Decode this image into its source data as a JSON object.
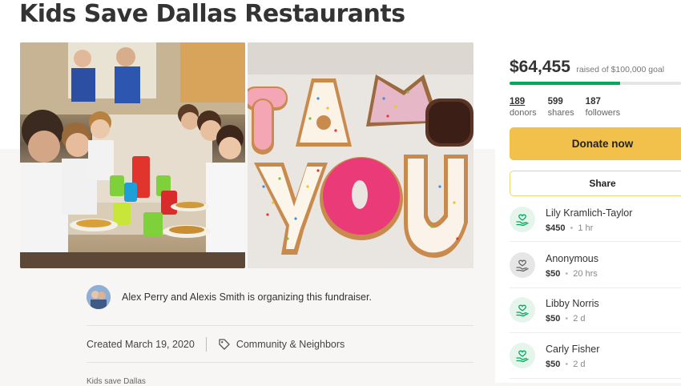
{
  "campaign": {
    "title": "Kids Save Dallas Restaurants",
    "organizer_text": "Alex Perry and Alexis Smith is organizing this fundraiser.",
    "created": "Created March 19, 2020",
    "category": "Community & Neighbors",
    "story_start": "Kids save Dallas"
  },
  "photos": {
    "right_letters": [
      "T",
      "H",
      "A",
      "N",
      "K",
      "Y",
      "O",
      "U"
    ]
  },
  "sidebar": {
    "raised": "$64,455",
    "goal_text": "raised of $100,000 goal",
    "progress_fraction": 0.645,
    "stats": [
      {
        "value": "189",
        "label": "donors"
      },
      {
        "value": "599",
        "label": "shares"
      },
      {
        "value": "187",
        "label": "followers"
      }
    ],
    "donate_label": "Donate now",
    "share_label": "Share",
    "donations": [
      {
        "name": "Lily Kramlich-Taylor",
        "amount": "$450",
        "time": "1 hr",
        "icon": "heart-hand-icon",
        "color": "#e6f5ec"
      },
      {
        "name": "Anonymous",
        "amount": "$50",
        "time": "20 hrs",
        "icon": "heart-hand-icon",
        "color": "#e6e6e6"
      },
      {
        "name": "Libby Norris",
        "amount": "$50",
        "time": "2 d",
        "icon": "heart-hand-icon",
        "color": "#e6f5ec"
      },
      {
        "name": "Carly Fisher",
        "amount": "$50",
        "time": "2 d",
        "icon": "heart-hand-icon",
        "color": "#e6f5ec"
      }
    ]
  },
  "colors": {
    "accent_green": "#02a95c",
    "donate_yellow": "#f2c14c"
  }
}
